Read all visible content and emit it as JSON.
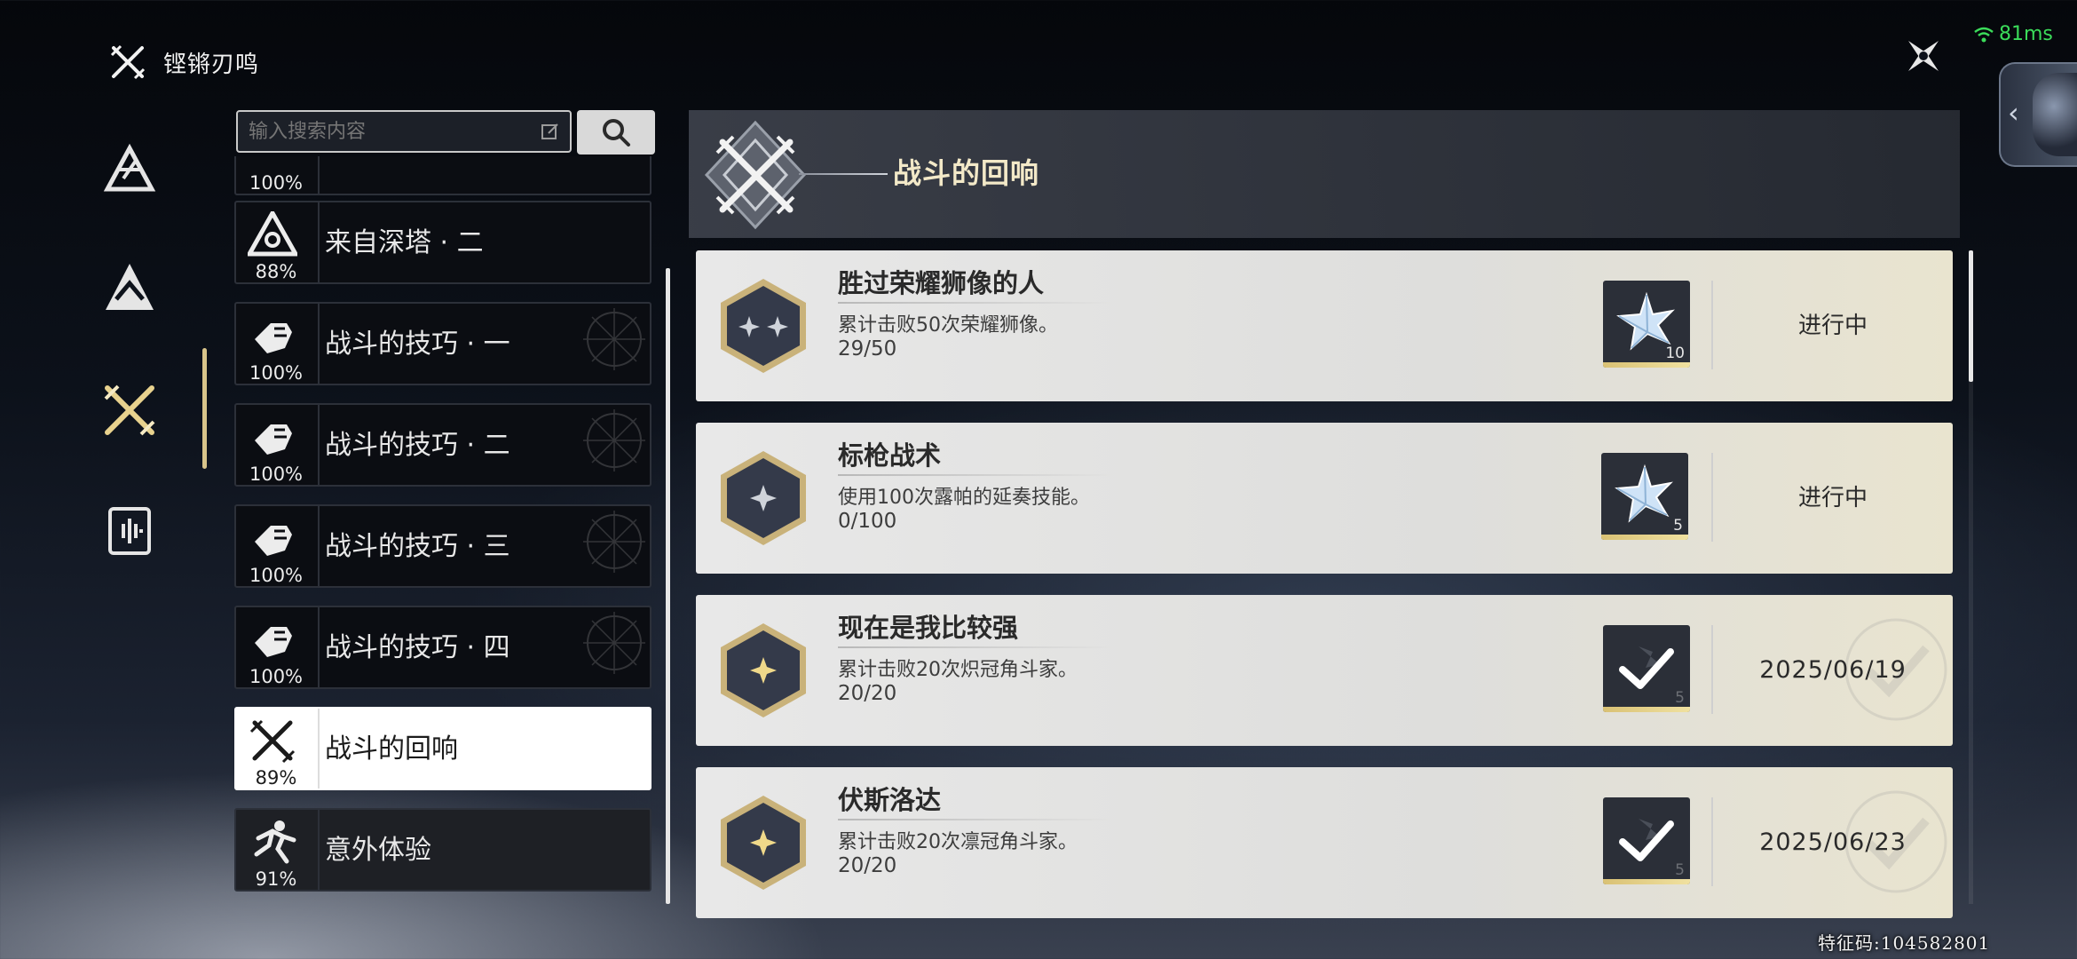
{
  "brand": {
    "icon": "crossed-blades-icon",
    "title": "铿锵刃鸣"
  },
  "status_bar": {
    "ping": "81ms",
    "wifi_icon": "wifi-icon"
  },
  "top_right": {
    "close_icon": "close-star-icon"
  },
  "rail": [
    {
      "icon": "triangle-sigil-icon",
      "active": false
    },
    {
      "icon": "mountain-sigil-icon",
      "active": false
    },
    {
      "icon": "crossed-blades-icon",
      "active": true
    },
    {
      "icon": "sound-wave-icon",
      "active": false
    }
  ],
  "search": {
    "placeholder": "输入搜索内容",
    "value": "",
    "button_icon": "search-icon"
  },
  "list": [
    {
      "label": "",
      "pct": "100%",
      "icon": "fist-icon",
      "state": "normal"
    },
    {
      "label": "来自深塔 · 二",
      "pct": "88%",
      "icon": "tower-icon",
      "state": "normal"
    },
    {
      "label": "战斗的技巧 · 一",
      "pct": "100%",
      "icon": "fist-icon",
      "state": "normal"
    },
    {
      "label": "战斗的技巧 · 二",
      "pct": "100%",
      "icon": "fist-icon",
      "state": "normal"
    },
    {
      "label": "战斗的技巧 · 三",
      "pct": "100%",
      "icon": "fist-icon",
      "state": "normal"
    },
    {
      "label": "战斗的技巧 · 四",
      "pct": "100%",
      "icon": "fist-icon",
      "state": "normal"
    },
    {
      "label": "战斗的回响",
      "pct": "89%",
      "icon": "crossed-swords-icon",
      "state": "selected"
    },
    {
      "label": "意外体验",
      "pct": "91%",
      "icon": "running-figure-icon",
      "state": "dim"
    }
  ],
  "header": {
    "title": "战斗的回响",
    "emblem": "crossed-swords-emblem-icon"
  },
  "achievements": [
    {
      "title": "胜过荣耀狮像的人",
      "desc": "累计击败50次荣耀狮像。",
      "progress": "29/50",
      "progress_fraction": 0.58,
      "reward_count": "10",
      "reward_icon": "star-crystal-icon",
      "status": "进行中",
      "completed": false,
      "badge": "two-star-hex-badge"
    },
    {
      "title": "标枪战术",
      "desc": "使用100次露帕的延奏技能。",
      "progress": "0/100",
      "progress_fraction": 0.0,
      "reward_count": "5",
      "reward_icon": "star-crystal-icon",
      "status": "进行中",
      "completed": false,
      "badge": "one-star-hex-badge"
    },
    {
      "title": "现在是我比较强",
      "desc": "累计击败20次炽冠角斗家。",
      "progress": "20/20",
      "progress_fraction": 1.0,
      "reward_count": "5",
      "reward_icon": "check-icon",
      "status": "2025/06/19",
      "completed": true,
      "badge": "gold-star-hex-badge"
    },
    {
      "title": "伏斯洛达",
      "desc": "累计击败20次凛冠角斗家。",
      "progress": "20/20",
      "progress_fraction": 1.0,
      "reward_count": "5",
      "reward_icon": "check-icon",
      "status": "2025/06/23",
      "completed": true,
      "badge": "gold-star-hex-badge"
    }
  ],
  "watermark": "特征码:104582801",
  "colors": {
    "accent_gold": "#d8c48a",
    "title_gold": "#f3e9c8",
    "ping_green": "#3bdc5a"
  }
}
